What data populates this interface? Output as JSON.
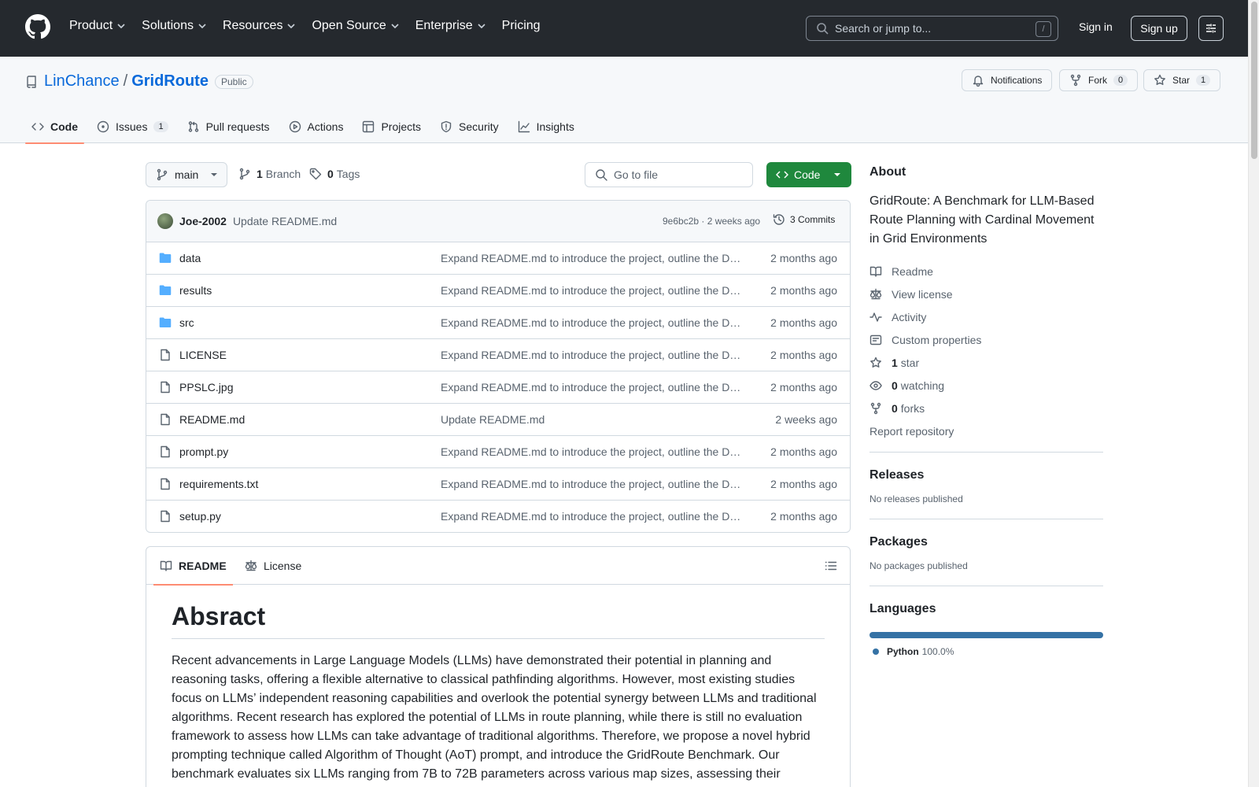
{
  "header": {
    "nav": [
      "Product",
      "Solutions",
      "Resources",
      "Open Source",
      "Enterprise",
      "Pricing"
    ],
    "search_placeholder": "Search or jump to...",
    "search_shortcut": "/",
    "signin": "Sign in",
    "signup": "Sign up"
  },
  "repo": {
    "owner": "LinChance",
    "separator": "/",
    "name": "GridRoute",
    "visibility": "Public",
    "notifications": "Notifications",
    "fork_label": "Fork",
    "fork_count": "0",
    "star_label": "Star",
    "star_count": "1",
    "tabs": [
      {
        "label": "Code",
        "count": ""
      },
      {
        "label": "Issues",
        "count": "1"
      },
      {
        "label": "Pull requests",
        "count": ""
      },
      {
        "label": "Actions",
        "count": ""
      },
      {
        "label": "Projects",
        "count": ""
      },
      {
        "label": "Security",
        "count": ""
      },
      {
        "label": "Insights",
        "count": ""
      }
    ]
  },
  "toolbar": {
    "branch": "main",
    "branches_count": "1",
    "branches_label": "Branch",
    "tags_count": "0",
    "tags_label": "Tags",
    "goto_file": "Go to file",
    "code_button": "Code"
  },
  "commit": {
    "author": "Joe-2002",
    "message": "Update README.md",
    "hash_age": "9e6bc2b · 2 weeks ago",
    "commits": "3 Commits"
  },
  "files": [
    {
      "name": "data",
      "type": "dir",
      "message": "Expand README.md to introduce the project, outline the D…",
      "age": "2 months ago"
    },
    {
      "name": "results",
      "type": "dir",
      "message": "Expand README.md to introduce the project, outline the D…",
      "age": "2 months ago"
    },
    {
      "name": "src",
      "type": "dir",
      "message": "Expand README.md to introduce the project, outline the D…",
      "age": "2 months ago"
    },
    {
      "name": "LICENSE",
      "type": "file",
      "message": "Expand README.md to introduce the project, outline the D…",
      "age": "2 months ago"
    },
    {
      "name": "PPSLC.jpg",
      "type": "file",
      "message": "Expand README.md to introduce the project, outline the D…",
      "age": "2 months ago"
    },
    {
      "name": "README.md",
      "type": "file",
      "message": "Update README.md",
      "age": "2 weeks ago"
    },
    {
      "name": "prompt.py",
      "type": "file",
      "message": "Expand README.md to introduce the project, outline the D…",
      "age": "2 months ago"
    },
    {
      "name": "requirements.txt",
      "type": "file",
      "message": "Expand README.md to introduce the project, outline the D…",
      "age": "2 months ago"
    },
    {
      "name": "setup.py",
      "type": "file",
      "message": "Expand README.md to introduce the project, outline the D…",
      "age": "2 months ago"
    }
  ],
  "readme": {
    "tab_readme": "README",
    "tab_license": "License",
    "heading": "Absract",
    "body": "Recent advancements in Large Language Models (LLMs) have demonstrated their potential in planning and reasoning tasks, offering a flexible alternative to classical pathfinding algorithms. However, most existing studies focus on LLMs’ independent reasoning capabilities and overlook the potential synergy between LLMs and traditional algorithms. Recent research has explored the potential of LLMs in route planning, while there is still no evaluation framework to assess how LLMs can take advantage of traditional algorithms. Therefore, we propose a novel hybrid prompting technique called Algorithm of Thought (AoT) prompt, and introduce the GridRoute Benchmark. Our benchmark evaluates six LLMs ranging from 7B to 72B parameters across various map sizes, assessing their"
  },
  "about": {
    "title": "About",
    "description": "GridRoute: A Benchmark for LLM-Based Route Planning with Cardinal Movement in Grid Environments",
    "readme": "Readme",
    "license": "View license",
    "activity": "Activity",
    "custom_properties": "Custom properties",
    "stars_count": "1",
    "stars_label": "star",
    "watching_count": "0",
    "watching_label": "watching",
    "forks_count": "0",
    "forks_label": "forks",
    "report": "Report repository"
  },
  "releases": {
    "title": "Releases",
    "text": "No releases published"
  },
  "packages": {
    "title": "Packages",
    "text": "No packages published"
  },
  "languages": {
    "title": "Languages",
    "items": [
      {
        "name": "Python",
        "percent": "100.0%",
        "fraction": 1.0,
        "color": "#3572a5"
      }
    ]
  },
  "colors": {
    "header_bg": "#25292e",
    "link": "#0969da",
    "code_button": "#1f883d",
    "tab_underline": "#fd8c73"
  }
}
